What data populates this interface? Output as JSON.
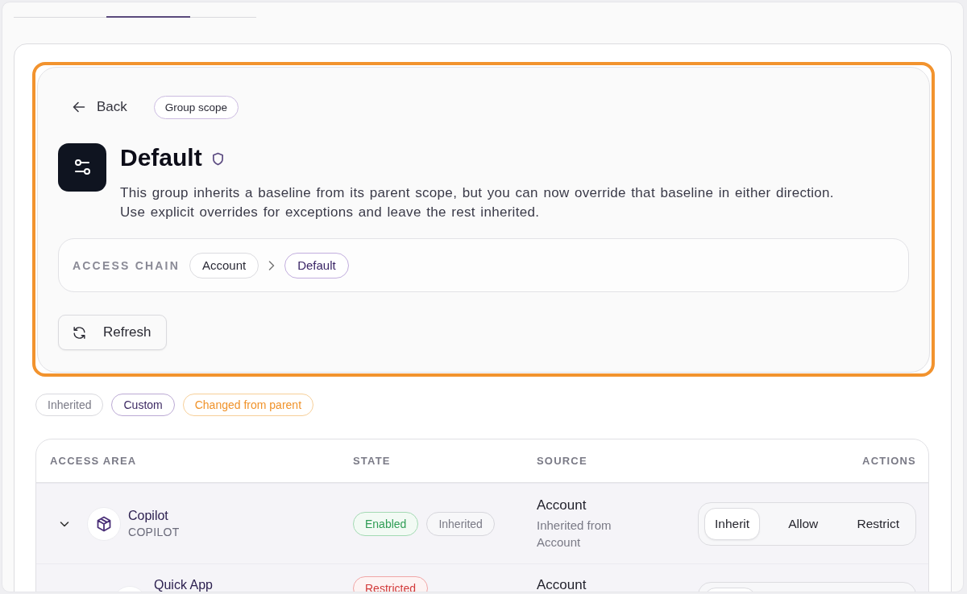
{
  "tabs": [
    {
      "selected": false
    },
    {
      "selected": true
    },
    {
      "selected": false
    }
  ],
  "panel": {
    "back_label": "Back",
    "scope_badge": "Group scope",
    "title": "Default",
    "description": "This group inherits a baseline from its parent scope, but you can now override that baseline in either direction. Use explicit overrides for exceptions and leave the rest inherited.",
    "access_chain": {
      "label": "ACCESS CHAIN",
      "steps": [
        {
          "label": "Account",
          "current": false
        },
        {
          "label": "Default",
          "current": true
        }
      ]
    },
    "refresh_label": "Refresh"
  },
  "legend": [
    {
      "label": "Inherited",
      "kind": "inherited"
    },
    {
      "label": "Custom",
      "kind": "custom"
    },
    {
      "label": "Changed from parent",
      "kind": "changed"
    }
  ],
  "table": {
    "columns": [
      "ACCESS AREA",
      "STATE",
      "SOURCE",
      "ACTIONS"
    ],
    "rows": [
      {
        "name": "Copilot",
        "code": "COPILOT",
        "expanded": true,
        "states": [
          {
            "label": "Enabled",
            "kind": "enabled"
          },
          {
            "label": "Inherited",
            "kind": "inherited"
          }
        ],
        "source": "Account",
        "source_note": "Inherited from Account",
        "actions": [
          {
            "label": "Inherit",
            "selected": true
          },
          {
            "label": "Allow",
            "selected": false
          },
          {
            "label": "Restrict",
            "selected": false
          }
        ],
        "children": [
          {
            "name": "Quick App",
            "states": [
              {
                "label": "Restricted",
                "kind": "restricted"
              }
            ],
            "source": "Account",
            "actions": [
              {
                "selected": true
              },
              {
                "selected": false
              },
              {
                "selected": false
              }
            ]
          }
        ]
      }
    ]
  }
}
